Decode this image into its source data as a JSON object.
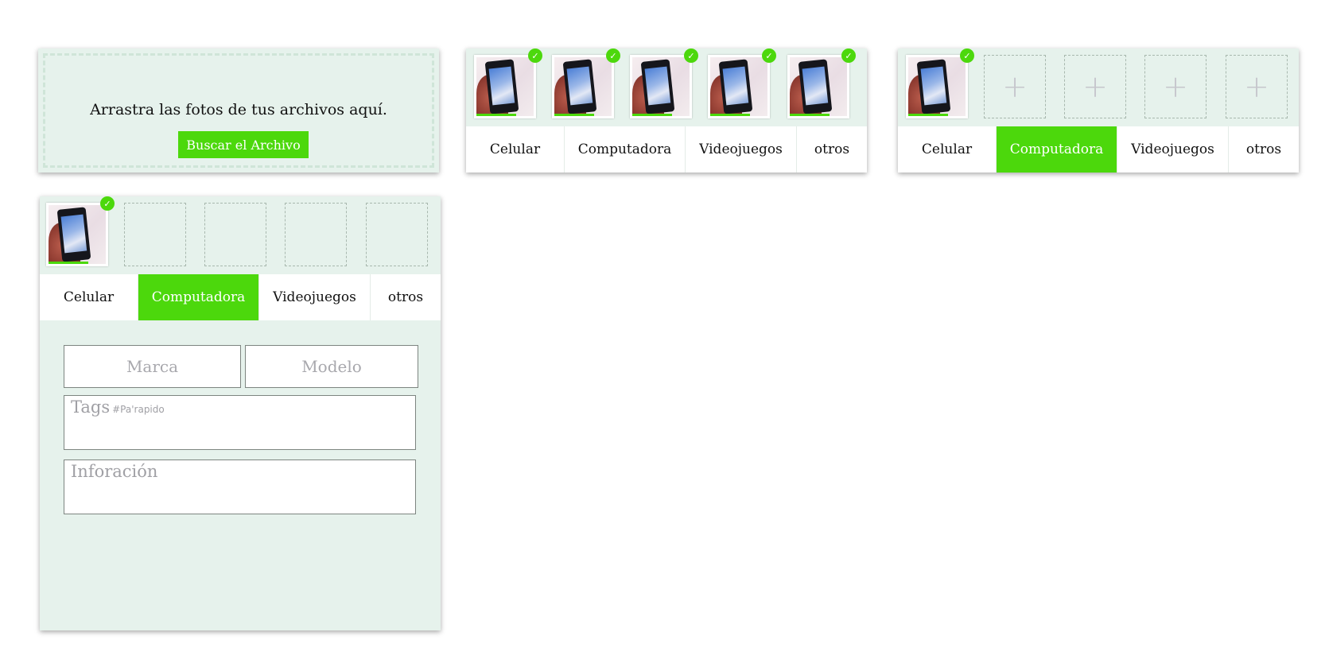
{
  "upload": {
    "drop_text": "Arrastra las fotos de tus archivos aquí.",
    "browse_label": "Buscar el Archivo"
  },
  "categories": [
    "Celular",
    "Computadora",
    "Videojuegos",
    "otros"
  ],
  "check_glyph": "✓",
  "add_glyph": "+",
  "form": {
    "brand_placeholder": "Marca",
    "model_placeholder": "Modelo",
    "tags_label": "Tags",
    "tags_hint": "#Pa'rapido",
    "info_label": "Inforación"
  },
  "colors": {
    "accent": "#4cd80c",
    "panel_bg": "#e6f2ec"
  },
  "states": {
    "panel2_active_tab": null,
    "panel3_active_tab": "Computadora",
    "panel4_active_tab": "Computadora"
  }
}
